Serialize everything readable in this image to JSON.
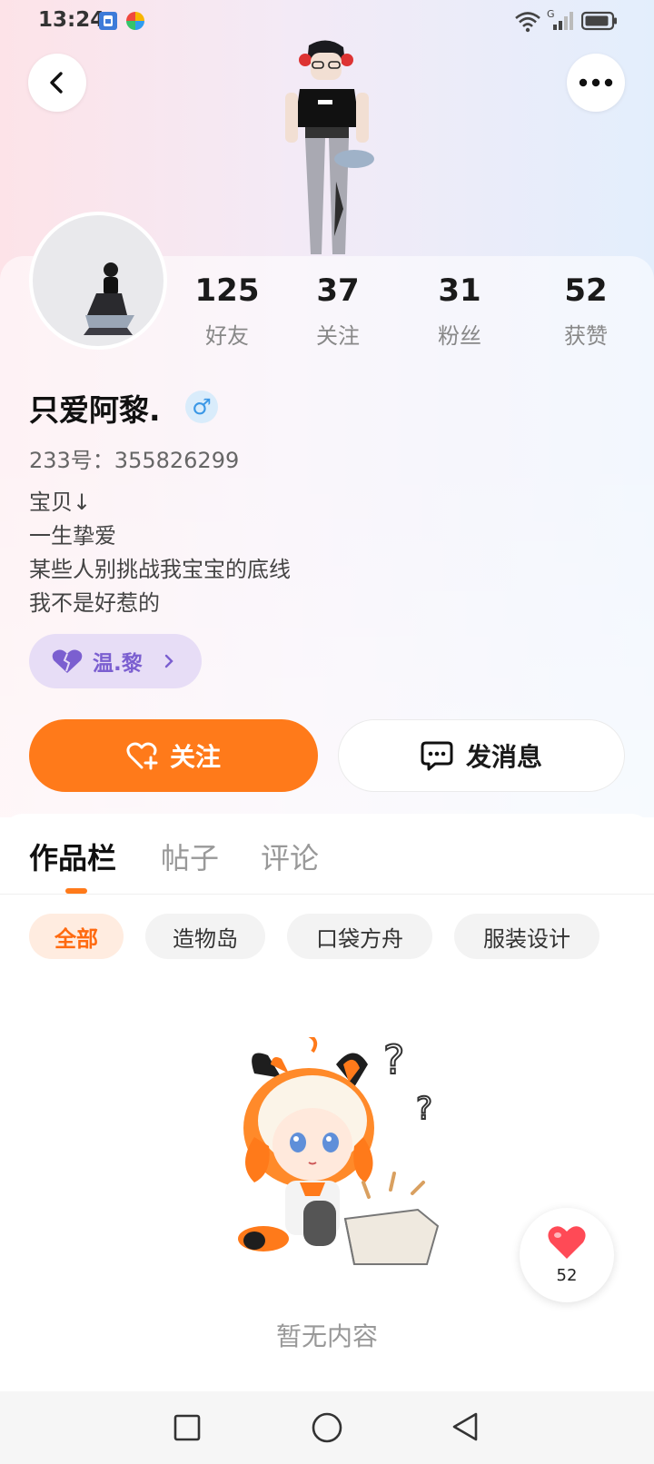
{
  "status_bar": {
    "time": "13:24",
    "icons": [
      "sim-card-icon",
      "pinwheel-app-icon",
      "wifi-icon",
      "cell-signal-icon",
      "battery-icon"
    ],
    "network_label": "G"
  },
  "header": {
    "back_icon": "chevron-left-icon",
    "more_icon": "ellipsis-icon"
  },
  "profile": {
    "stats": [
      {
        "value": "125",
        "label": "好友"
      },
      {
        "value": "37",
        "label": "关注"
      },
      {
        "value": "31",
        "label": "粉丝"
      },
      {
        "value": "52",
        "label": "获赞"
      }
    ],
    "nickname": "只爱阿黎.",
    "gender_symbol": "♂",
    "uid_text": "233号：355826299",
    "bio_lines": [
      "宝贝↓",
      "一生挚爱",
      "某些人别挑战我宝宝的底线",
      "我不是好惹的"
    ],
    "group_label": "温.黎",
    "follow_label": "关注",
    "message_label": "发消息"
  },
  "tabs": [
    {
      "label": "作品栏",
      "active": true
    },
    {
      "label": "帖子",
      "active": false
    },
    {
      "label": "评论",
      "active": false
    }
  ],
  "chips": [
    {
      "label": "全部",
      "active": true
    },
    {
      "label": "造物岛",
      "active": false
    },
    {
      "label": "口袋方舟",
      "active": false
    },
    {
      "label": "服装设计",
      "active": false
    }
  ],
  "empty_state": {
    "text": "暂无内容"
  },
  "like_button": {
    "count": "52"
  },
  "colors": {
    "accent": "#ff7a1a",
    "group_purple": "#7b5fd0",
    "gender_blue": "#3a97e6"
  }
}
